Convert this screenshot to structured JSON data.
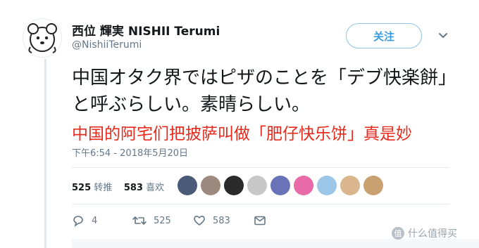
{
  "user": {
    "display_name": "西位 輝実 NISHII Terumi",
    "handle": "@NishiiTerumi"
  },
  "follow_label": "关注",
  "tweet": {
    "text": "中国オタク界ではピザのことを「デブ快楽餅」と呼ぶらしい。素晴らしい。"
  },
  "translation": "中国的阿宅们把披萨叫做「肥仔快乐饼」真是妙",
  "timestamp": "下午6:54 - 2018年5月20日",
  "stats": {
    "retweets_count": "525",
    "retweets_label": "转推",
    "likes_count": "583",
    "likes_label": "喜欢"
  },
  "likers": [
    {
      "name": "liker-1",
      "color": "#4a5a78"
    },
    {
      "name": "liker-2",
      "color": "#9b8a7d"
    },
    {
      "name": "liker-3",
      "color": "#2a2a2a"
    },
    {
      "name": "liker-4",
      "color": "#c8c8c8"
    },
    {
      "name": "liker-5",
      "color": "#6b73b8"
    },
    {
      "name": "liker-6",
      "color": "#e86aa6"
    },
    {
      "name": "liker-7",
      "color": "#9cc7e8"
    },
    {
      "name": "liker-8",
      "color": "#d9b68e"
    },
    {
      "name": "liker-9",
      "color": "#c9a070"
    }
  ],
  "actions": {
    "reply_count": "4",
    "retweet_count": "525",
    "like_count": "583"
  },
  "icons": [
    "reply-icon",
    "retweet-icon",
    "like-icon",
    "message-icon",
    "chevron-down-icon"
  ],
  "watermark": "什么值得买"
}
